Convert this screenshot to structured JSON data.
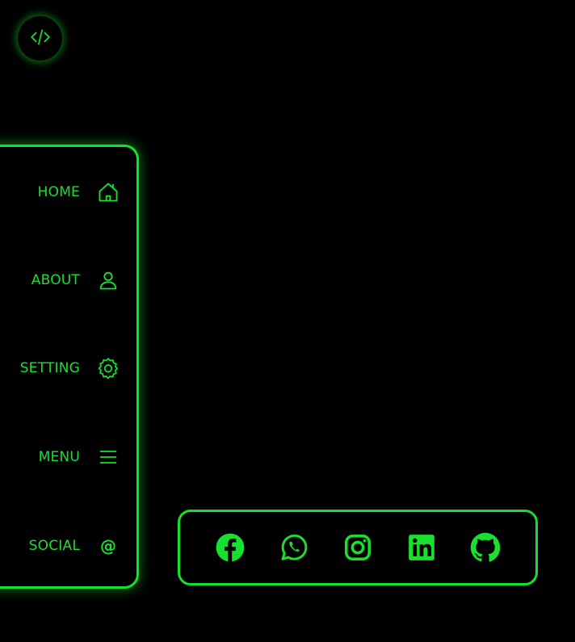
{
  "toggle": {
    "icon": "code-icon"
  },
  "sidebar": {
    "items": [
      {
        "label": "HOME",
        "icon": "home-icon"
      },
      {
        "label": "ABOUT",
        "icon": "user-icon"
      },
      {
        "label": "SETTING",
        "icon": "gear-icon"
      },
      {
        "label": "MENU",
        "icon": "menu-icon"
      },
      {
        "label": "SOCIAL",
        "icon": "at-icon",
        "glyph": "@"
      }
    ]
  },
  "social": {
    "icons": [
      "facebook-icon",
      "whatsapp-icon",
      "instagram-icon",
      "linkedin-icon",
      "github-icon"
    ]
  },
  "colors": {
    "accent": "#13e22b",
    "background": "#000000"
  }
}
